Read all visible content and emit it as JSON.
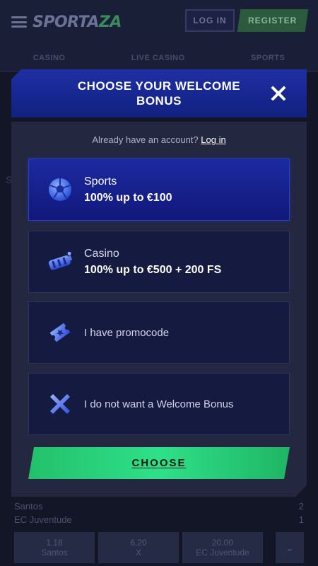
{
  "header": {
    "logo": {
      "main": "SPORTA",
      "accent": "ZA"
    },
    "login_label": "LOG IN",
    "register_label": "REGISTER"
  },
  "nav": {
    "items": [
      "CASINO",
      "LIVE CASINO",
      "SPORTS"
    ]
  },
  "modal": {
    "title": "CHOOSE YOUR WELCOME BONUS",
    "account_prompt": "Already have an account?",
    "login_link": "Log in",
    "options": [
      {
        "title": "Sports",
        "subtitle": "100% up to €100",
        "icon": "soccer-ball-icon",
        "selected": true
      },
      {
        "title": "Casino",
        "subtitle": "100% up to €500 + 200 FS",
        "icon": "slot-reel-icon",
        "selected": false
      },
      {
        "title": "I have promocode",
        "icon": "ticket-icon",
        "selected": false
      },
      {
        "title": "I do not want a Welcome Bonus",
        "icon": "cross-icon",
        "selected": false
      }
    ],
    "choose_label": "CHOOSE"
  },
  "background_match": {
    "team_home": "Santos",
    "team_away": "EC Juventude",
    "score_home": "2",
    "score_away": "1",
    "odds": [
      {
        "value": "1.18",
        "label": "Santos"
      },
      {
        "value": "6.20",
        "label": "X"
      },
      {
        "value": "20.00",
        "label": "EC Juventude"
      }
    ],
    "side_text": "S"
  },
  "colors": {
    "brand_blue": "#1e2fa3",
    "accent_green": "#2fe08a",
    "modal_bg": "#232740",
    "option_bg": "#151a40"
  }
}
